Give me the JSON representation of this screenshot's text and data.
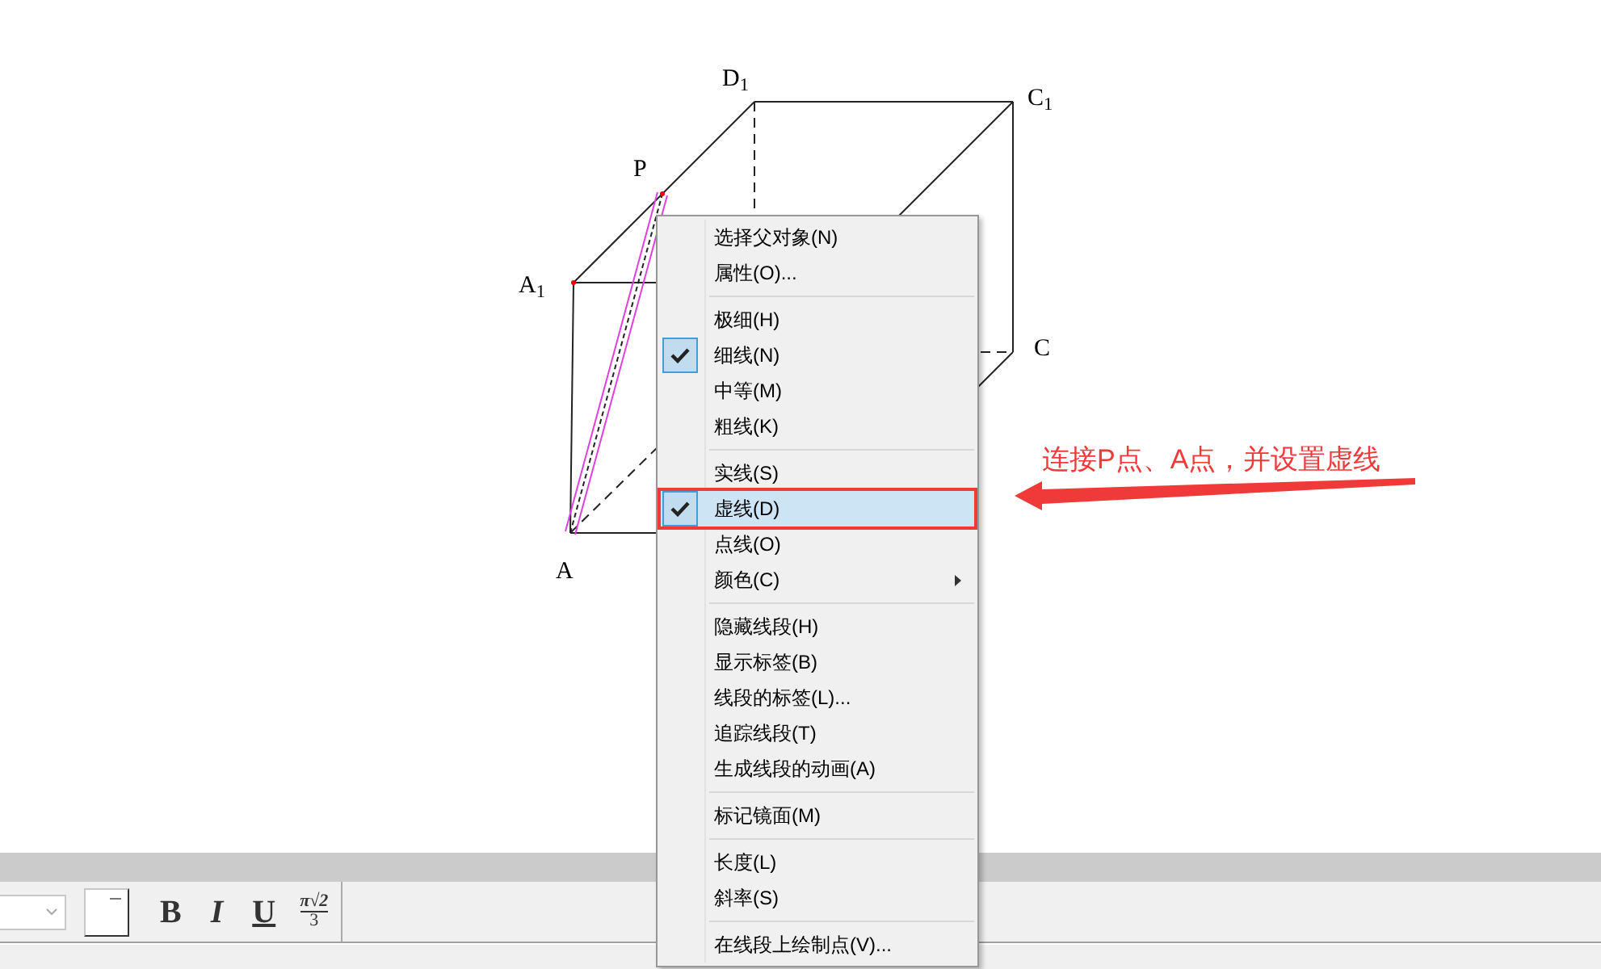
{
  "figure": {
    "labels": [
      {
        "text": "D$_{1}$",
        "kind": "D1"
      },
      {
        "text": "C$_{1}$",
        "kind": "C1"
      },
      {
        "text": "P",
        "kind": "P"
      },
      {
        "text": "A$_{1}$",
        "kind": "A1"
      },
      {
        "text": "C",
        "kind": "C"
      },
      {
        "text": "A",
        "kind": "A"
      }
    ]
  },
  "context_menu": {
    "groups": [
      [
        {
          "label": "选择父对象(N)",
          "checked": false,
          "selected": false
        },
        {
          "label": "属性(O)...",
          "checked": false,
          "selected": false
        }
      ],
      [
        {
          "label": "极细(H)",
          "checked": false,
          "selected": false
        },
        {
          "label": "细线(N)",
          "checked": true,
          "selected": false
        },
        {
          "label": "中等(M)",
          "checked": false,
          "selected": false
        },
        {
          "label": "粗线(K)",
          "checked": false,
          "selected": false
        }
      ],
      [
        {
          "label": "实线(S)",
          "checked": false,
          "selected": false
        },
        {
          "label": "虚线(D)",
          "checked": true,
          "selected": true
        },
        {
          "label": "点线(O)",
          "checked": false,
          "selected": false
        },
        {
          "label": "颜色(C)",
          "checked": false,
          "selected": false,
          "submenu": true
        }
      ],
      [
        {
          "label": "隐藏线段(H)",
          "checked": false,
          "selected": false
        },
        {
          "label": "显示标签(B)",
          "checked": false,
          "selected": false
        },
        {
          "label": "线段的标签(L)...",
          "checked": false,
          "selected": false
        },
        {
          "label": "追踪线段(T)",
          "checked": false,
          "selected": false
        },
        {
          "label": "生成线段的动画(A)",
          "checked": false,
          "selected": false
        }
      ],
      [
        {
          "label": "标记镜面(M)",
          "checked": false,
          "selected": false
        }
      ],
      [
        {
          "label": "长度(L)",
          "checked": false,
          "selected": false
        },
        {
          "label": "斜率(S)",
          "checked": false,
          "selected": false
        }
      ],
      [
        {
          "label": "在线段上绘制点(V)...",
          "checked": false,
          "selected": false
        }
      ]
    ]
  },
  "annotation": {
    "text": "连接P点、A点，并设置虚线"
  },
  "toolbar": {
    "buttons": [
      {
        "kind": "bold",
        "label": "B"
      },
      {
        "kind": "italic",
        "label": "I"
      },
      {
        "kind": "underline",
        "label": "U"
      },
      {
        "kind": "formula",
        "numerator": "π√2",
        "denominator": "3"
      }
    ]
  }
}
